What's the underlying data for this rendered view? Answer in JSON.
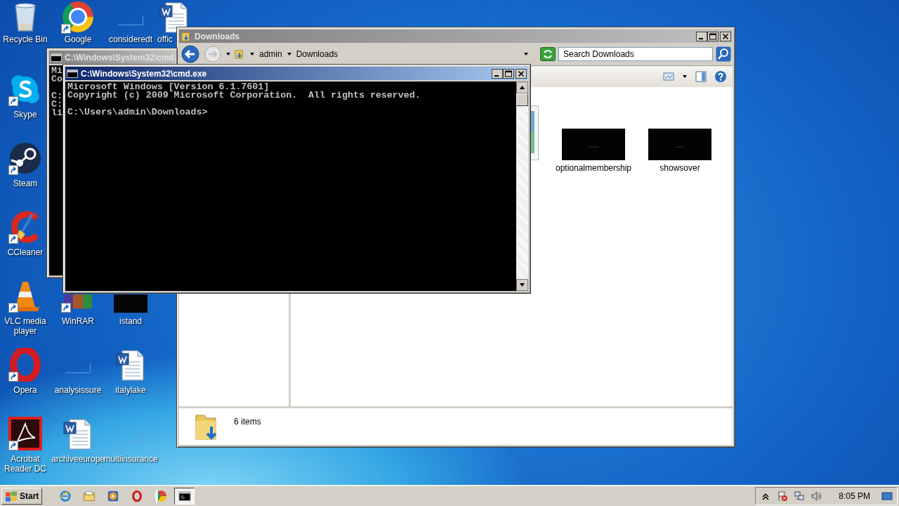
{
  "desktop_icons": [
    {
      "label": "Recycle Bin",
      "kind": "recycle",
      "shortcut": false
    },
    {
      "label": "Google",
      "kind": "chrome",
      "shortcut": true
    },
    {
      "label": "consideredt",
      "kind": "blank",
      "shortcut": false
    },
    {
      "label": "offic",
      "kind": "word",
      "shortcut": false
    },
    {
      "label": "Skype",
      "kind": "skype",
      "shortcut": true
    },
    {
      "label": "Steam",
      "kind": "steam",
      "shortcut": true
    },
    {
      "label": "CCleaner",
      "kind": "ccleaner",
      "shortcut": true
    },
    {
      "label": "VLC media player",
      "kind": "vlc",
      "shortcut": true
    },
    {
      "label": "WinRAR",
      "kind": "winrar",
      "shortcut": true
    },
    {
      "label": "istand",
      "kind": "dark",
      "shortcut": false
    },
    {
      "label": "Opera",
      "kind": "opera",
      "shortcut": true
    },
    {
      "label": "analysissure",
      "kind": "blank",
      "shortcut": false
    },
    {
      "label": "italylake",
      "kind": "word",
      "shortcut": false
    },
    {
      "label": "Acrobat Reader DC",
      "kind": "acrobat",
      "shortcut": true
    },
    {
      "label": "archiveeurope",
      "kind": "word",
      "shortcut": false
    },
    {
      "label": "multiinsurance",
      "kind": "blank",
      "shortcut": false
    }
  ],
  "explorer": {
    "title": "Downloads",
    "active": false,
    "breadcrumb": [
      "admin",
      "Downloads"
    ],
    "search": {
      "placeholder": "Search Downloads"
    },
    "files": [
      {
        "kind": "image"
      },
      {
        "kind": "dark",
        "label": "optionalmembership"
      },
      {
        "kind": "dark",
        "label": "showsover"
      }
    ],
    "status": "6 items"
  },
  "cmd_windows": [
    {
      "title": "C:\\Windows\\System32\\cmd",
      "active": false,
      "paragraphs": [
        [
          "Mi",
          "Co"
        ],
        [
          "C:",
          "C:",
          "li"
        ]
      ]
    },
    {
      "title": "C:\\Windows\\System32\\cmd.exe",
      "active": true,
      "paragraphs": [
        [
          "Microsoft Windows [Version 6.1.7601]",
          "Copyright (c) 2009 Microsoft Corporation.  All rights reserved."
        ],
        [
          "C:\\Users\\admin\\Downloads>"
        ]
      ]
    }
  ],
  "taskbar": {
    "start": "Start",
    "apps": [
      {
        "kind": "ie",
        "selected": false
      },
      {
        "kind": "explorer",
        "selected": false
      },
      {
        "kind": "media",
        "selected": false
      },
      {
        "kind": "opera",
        "selected": false
      },
      {
        "kind": "chrome",
        "selected": false
      },
      {
        "kind": "cmd",
        "selected": true
      }
    ],
    "tray": [
      {
        "kind": "chevron"
      },
      {
        "kind": "flag"
      },
      {
        "kind": "network"
      },
      {
        "kind": "speaker"
      }
    ],
    "clock": "8:05 PM"
  }
}
